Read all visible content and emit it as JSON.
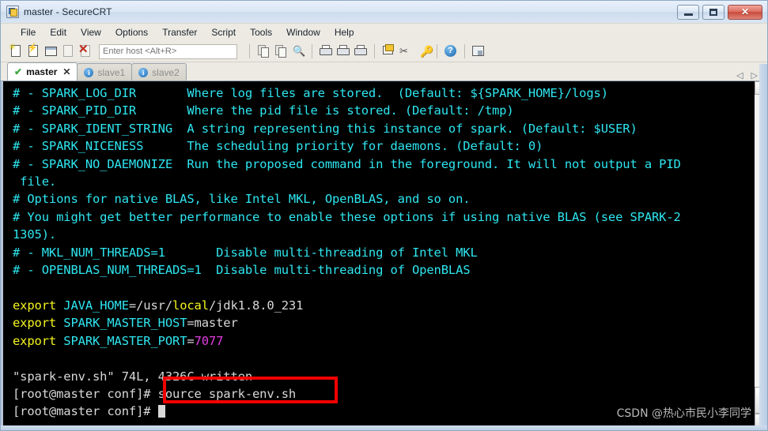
{
  "window": {
    "title": "master - SecureCRT",
    "icon": "securecrt-app-icon",
    "buttons": {
      "minimize": "minimize-icon",
      "maximize": "maximize-icon",
      "close": "✕"
    }
  },
  "menubar": {
    "items": [
      "File",
      "Edit",
      "View",
      "Options",
      "Transfer",
      "Script",
      "Tools",
      "Window",
      "Help"
    ]
  },
  "toolbar": {
    "host_input": {
      "value": "",
      "placeholder": "Enter host <Alt+R>"
    },
    "icons": [
      "new-session-icon",
      "connect-icon",
      "new-tab-icon",
      "reconnect-icon",
      "disconnect-icon",
      "copy-icon",
      "paste-icon",
      "find-icon",
      "print-screen-icon",
      "log-session-icon",
      "print-icon",
      "session-options-icon",
      "global-options-icon",
      "key-icon",
      "help-icon",
      "arrange-windows-icon"
    ]
  },
  "tabs": {
    "items": [
      {
        "label": "master",
        "active": true,
        "status_icon": "green-check-icon",
        "closable": true
      },
      {
        "label": "slave1",
        "active": false,
        "status_icon": "info-icon",
        "closable": false
      },
      {
        "label": "slave2",
        "active": false,
        "status_icon": "info-icon",
        "closable": false
      }
    ],
    "nav": {
      "prev": "◁",
      "next": "▷"
    }
  },
  "terminal": {
    "colors": {
      "background": "#000000",
      "default_text": "#d8d8d8",
      "cyan": "#2ee6f0",
      "yellow": "#f5f51e",
      "magenta": "#e23de2"
    },
    "lines": [
      {
        "id": "l1",
        "segs": [
          {
            "t": "# - SPARK_LOG_DIR       Where log files are stored.  (Default: ${SPARK_HOME}/logs)",
            "c": "cy"
          }
        ]
      },
      {
        "id": "l2",
        "segs": [
          {
            "t": "# - SPARK_PID_DIR       Where the pid file is stored. (Default: /tmp)",
            "c": "cy"
          }
        ]
      },
      {
        "id": "l3",
        "segs": [
          {
            "t": "# - SPARK_IDENT_STRING  A string representing this instance of spark. (Default: $USER)",
            "c": "cy"
          }
        ]
      },
      {
        "id": "l4",
        "segs": [
          {
            "t": "# - SPARK_NICENESS      The scheduling priority for daemons. (Default: 0)",
            "c": "cy"
          }
        ]
      },
      {
        "id": "l5",
        "segs": [
          {
            "t": "# - SPARK_NO_DAEMONIZE  Run the proposed command in the foreground. It will not output a PID",
            "c": "cy"
          }
        ]
      },
      {
        "id": "l6",
        "segs": [
          {
            "t": " file.",
            "c": "cy"
          }
        ]
      },
      {
        "id": "l7",
        "segs": [
          {
            "t": "# Options for native BLAS, like Intel MKL, OpenBLAS, and so on.",
            "c": "cy"
          }
        ]
      },
      {
        "id": "l8",
        "segs": [
          {
            "t": "# You might get better performance to enable these options if using native BLAS (see SPARK-2",
            "c": "cy"
          }
        ]
      },
      {
        "id": "l9",
        "segs": [
          {
            "t": "1305).",
            "c": "cy"
          }
        ]
      },
      {
        "id": "l10",
        "segs": [
          {
            "t": "# - MKL_NUM_THREADS=1       Disable multi-threading of Intel MKL",
            "c": "cy"
          }
        ]
      },
      {
        "id": "l11",
        "segs": [
          {
            "t": "# - OPENBLAS_NUM_THREADS=1  Disable multi-threading of OpenBLAS",
            "c": "cy"
          }
        ]
      },
      {
        "id": "l12",
        "segs": [
          {
            "t": "",
            "c": "wh"
          }
        ]
      },
      {
        "id": "l13",
        "segs": [
          {
            "t": "export ",
            "c": "ye"
          },
          {
            "t": "JAVA_HOME",
            "c": "cy"
          },
          {
            "t": "=/usr/",
            "c": "wh"
          },
          {
            "t": "local",
            "c": "ye"
          },
          {
            "t": "/jdk1.8.0_231",
            "c": "wh"
          }
        ]
      },
      {
        "id": "l14",
        "segs": [
          {
            "t": "export ",
            "c": "ye"
          },
          {
            "t": "SPARK_MASTER_HOST",
            "c": "cy"
          },
          {
            "t": "=master",
            "c": "wh"
          }
        ]
      },
      {
        "id": "l15",
        "segs": [
          {
            "t": "export ",
            "c": "ye"
          },
          {
            "t": "SPARK_MASTER_PORT",
            "c": "cy"
          },
          {
            "t": "=",
            "c": "wh"
          },
          {
            "t": "7077",
            "c": "mg"
          }
        ]
      },
      {
        "id": "l16",
        "segs": [
          {
            "t": "",
            "c": "wh"
          }
        ]
      },
      {
        "id": "l17",
        "segs": [
          {
            "t": "\"spark-env.sh\" 74L, 4326C written",
            "c": "wh"
          }
        ]
      },
      {
        "id": "l18",
        "segs": [
          {
            "t": "[root@master conf]# source spark-env.sh",
            "c": "wh"
          }
        ]
      },
      {
        "id": "l19",
        "segs": [
          {
            "t": "[root@master conf]# ",
            "c": "wh"
          },
          {
            "t": "█",
            "c": "cursorblock"
          }
        ]
      }
    ],
    "scrollbar": {
      "up_arrow": "▲",
      "down_arrow": "▼",
      "thumb_position": "bottom"
    }
  },
  "annotation": {
    "red_box": {
      "color": "#f20000",
      "highlights": "source spark-env.sh"
    }
  },
  "watermark": {
    "text": "CSDN @热心市民小李同学"
  }
}
